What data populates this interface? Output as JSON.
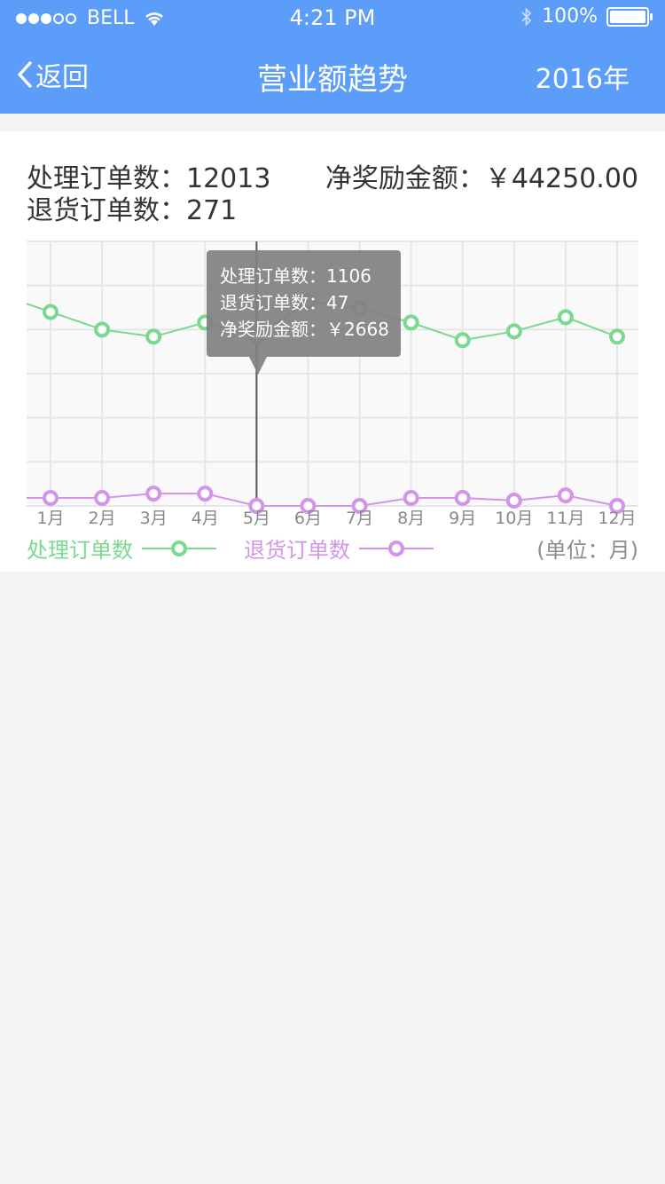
{
  "status_bar": {
    "carrier": "BELL",
    "time": "4:21 PM",
    "battery": "100%"
  },
  "nav": {
    "back_label": "返回",
    "title": "营业额趋势",
    "year": "2016年"
  },
  "summary": {
    "processed_text": "处理订单数：12013",
    "returned_text": "退货订单数：271",
    "bonus_text": "净奖励金额：￥44250.00"
  },
  "tooltip": {
    "line1": "处理订单数：1106",
    "line2": "退货订单数：47",
    "line3": "净奖励金额：￥2668"
  },
  "legend": {
    "processed": "处理订单数",
    "returned": "退货订单数",
    "unit": "(单位：月)"
  },
  "colors": {
    "header": "#5b9df8",
    "processed": "#7bd88f",
    "returned": "#d494ea"
  },
  "chart_data": {
    "type": "line",
    "categories": [
      "1月",
      "2月",
      "3月",
      "4月",
      "5月",
      "6月",
      "7月",
      "8月",
      "9月",
      "10月",
      "11月",
      "12月"
    ],
    "series": [
      {
        "name": "处理订单数",
        "values": [
          1100,
          1000,
          960,
          1040,
          960,
          1160,
          1120,
          1040,
          940,
          990,
          1070,
          960
        ]
      },
      {
        "name": "退货订单数",
        "values": [
          45,
          45,
          70,
          70,
          0,
          0,
          0,
          45,
          45,
          30,
          60,
          0
        ]
      }
    ],
    "ylim": [
      0,
      1500
    ],
    "grid": true,
    "selected_category": "5月",
    "legend_position": "bottom"
  }
}
